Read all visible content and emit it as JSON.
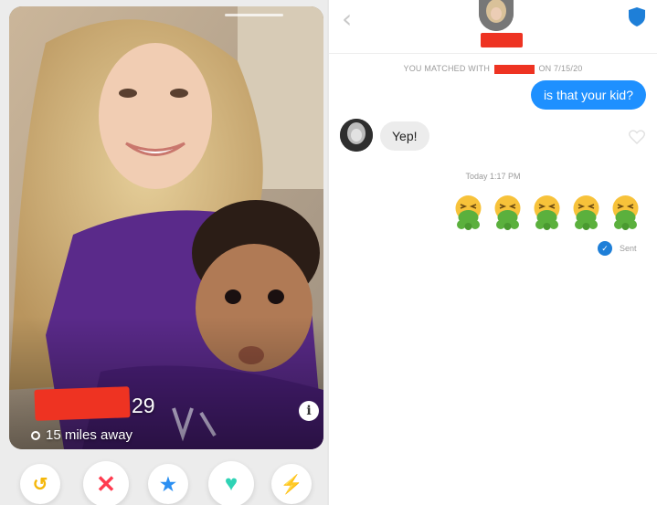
{
  "profile": {
    "age": "29",
    "distance": "15 miles away",
    "info_label": "i"
  },
  "actions": {
    "rewind_glyph": "↺",
    "nope_glyph": "✕",
    "superlike_glyph": "★",
    "like_glyph": "♥",
    "boost_glyph": "⚡"
  },
  "chat": {
    "back_glyph": "‹",
    "matched_prefix": "YOU MATCHED WITH",
    "matched_suffix": "ON 7/15/20",
    "outgoing_message": "is that your kid?",
    "incoming_message": "Yep!",
    "timestamp": "Today 1:17 PM",
    "status": "Sent",
    "emoji_count": 5
  },
  "colors": {
    "accent_blue": "#1e90ff",
    "redaction": "#ee3322",
    "nope_red": "#ff3b4f",
    "like_teal": "#2fd3b5",
    "superlike_blue": "#2b8ff2",
    "rewind_yellow": "#f5b70a",
    "boost_purple": "#a84cf3"
  },
  "icons": [
    "back-chevron-icon",
    "shield-icon",
    "heart-outline-icon",
    "location-pin-icon",
    "info-icon",
    "nauseated-face-emoji"
  ]
}
